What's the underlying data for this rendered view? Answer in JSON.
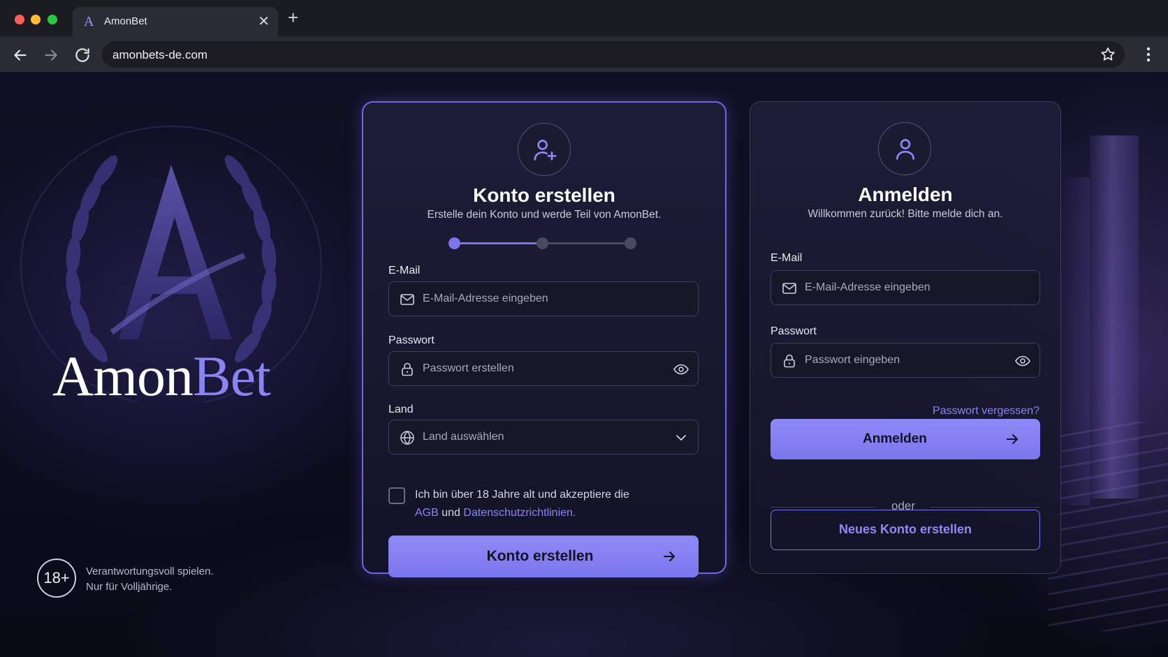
{
  "browser": {
    "tab_title": "AmonBet",
    "tab_favicon": "A",
    "url": "amonbets-de.com"
  },
  "brand": {
    "name_part1": "Amon",
    "name_part2": "Bet",
    "accent_color": "#8a84f2"
  },
  "footer": {
    "age_badge": "18+",
    "line1": "Verantwortungsvoll spielen.",
    "line2": "Nur für Volljährige."
  },
  "signup": {
    "title": "Konto erstellen",
    "subtitle": "Erstelle dein Konto und werde Teil von AmonBet.",
    "current_step": 1,
    "total_steps": 3,
    "email_label": "E-Mail",
    "email_placeholder": "E-Mail-Adresse eingeben",
    "password_label": "Passwort",
    "password_placeholder": "Passwort erstellen",
    "country_label": "Land",
    "country_placeholder": "Land auswählen",
    "terms_text_1": "Ich bin über 18 Jahre alt und akzeptiere die",
    "terms_link_agb": "AGB",
    "terms_and": "und",
    "terms_link_privacy": "Datenschutzrichtlinien",
    "terms_end": ".",
    "submit_label": "Konto erstellen"
  },
  "login": {
    "title": "Anmelden",
    "subtitle": "Willkommen zurück! Bitte melde dich an.",
    "email_label": "E-Mail",
    "email_placeholder": "E-Mail-Adresse eingeben",
    "password_label": "Passwort",
    "password_placeholder": "Passwort eingeben",
    "forgot_label": "Passwort vergessen?",
    "submit_label": "Anmelden",
    "or_label": "oder",
    "new_account_label": "Neues Konto erstellen"
  }
}
